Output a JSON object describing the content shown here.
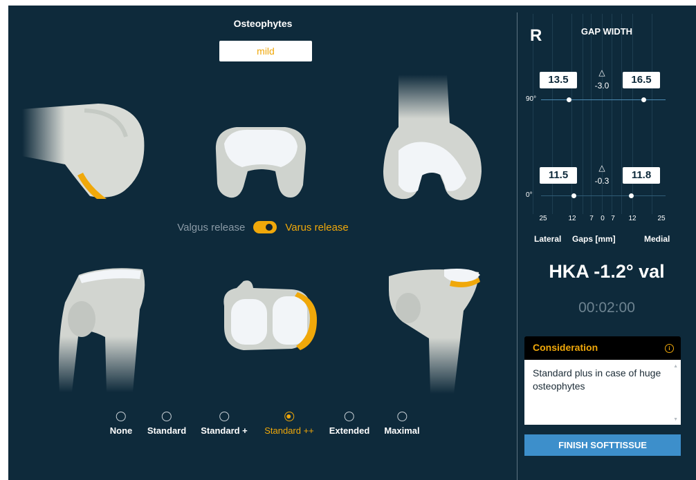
{
  "osteophytes": {
    "title": "Osteophytes",
    "severity": "mild"
  },
  "release_toggle": {
    "left_label": "Valgus release",
    "right_label": "Varus release",
    "state": "varus"
  },
  "release_options": {
    "selected": "Standard ++",
    "items": [
      {
        "label": "None"
      },
      {
        "label": "Standard"
      },
      {
        "label": "Standard +"
      },
      {
        "label": "Standard ++"
      },
      {
        "label": "Extended"
      },
      {
        "label": "Maximal"
      }
    ]
  },
  "gap_panel": {
    "side": "R",
    "title": "GAP WIDTH",
    "flexion": {
      "angle_label": "90°",
      "lateral": "13.5",
      "delta_symbol": "△",
      "delta": "-3.0",
      "medial": "16.5"
    },
    "extension": {
      "angle_label": "0°",
      "lateral": "11.5",
      "delta_symbol": "△",
      "delta": "-0.3",
      "medial": "11.8"
    },
    "scale_ticks": [
      "25",
      "12",
      "7",
      "0",
      "7",
      "12",
      "25"
    ],
    "lateral_label": "Lateral",
    "gaps_label": "Gaps [mm]",
    "medial_label": "Medial"
  },
  "hka": "HKA -1.2° val",
  "timer": "00:02:00",
  "consideration": {
    "title": "Consideration",
    "info_icon": "info-icon",
    "text": "Standard plus in case of huge osteophytes"
  },
  "finish_button": "FINISH SOFTTISSUE",
  "colors": {
    "background": "#0e2a3b",
    "accent": "#f0a80a",
    "button": "#3d8fcb",
    "line": "#4b8bb3"
  }
}
